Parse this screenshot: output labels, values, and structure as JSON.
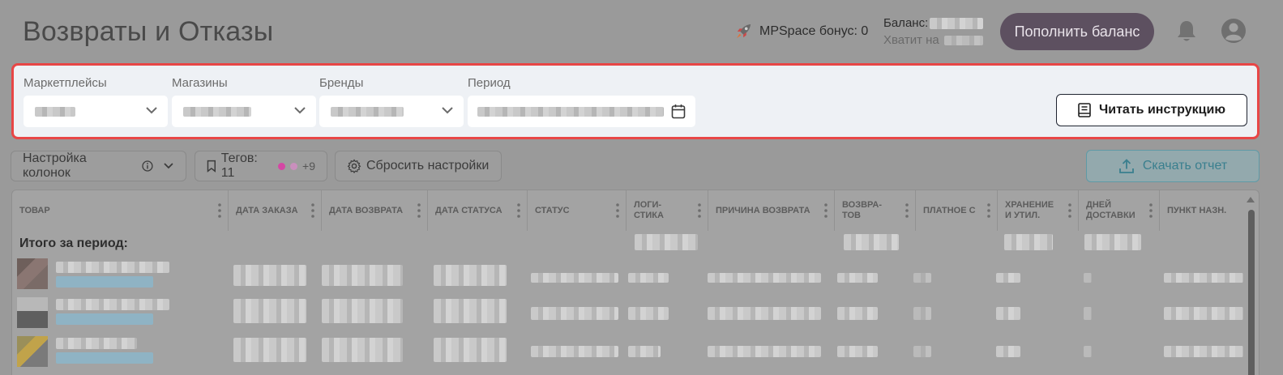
{
  "header": {
    "title": "Возвраты и Отказы",
    "bonus_label": "MPSpace бонус: 0",
    "balance_label": "Баланс:",
    "enough_label": "Хватит на",
    "topup_button": "Пополнить баланс"
  },
  "filters": {
    "marketplaces_label": "Маркетплейсы",
    "shops_label": "Магазины",
    "brands_label": "Бренды",
    "period_label": "Период",
    "instruction_button": "Читать инструкцию"
  },
  "toolbar": {
    "columns_button": "Настройка колонок",
    "tags_button": "Тегов: 11",
    "tags_more": "+9",
    "tag_colors": [
      "#e04fb0",
      "#d89bcc"
    ],
    "reset_button": "Сбросить настройки",
    "download_button": "Скачать отчет"
  },
  "table": {
    "columns": [
      "Товар",
      "Дата заказа",
      "Дата возврата",
      "Дата статуса",
      "Статус",
      "Логи-\nстика",
      "Причина возврата",
      "Возвра-\nтов",
      "Платное с",
      "Хранение\nи утил.",
      "Дней\nдоставки",
      "Пункт назн."
    ],
    "total_label": "Итого за период:"
  },
  "colors": {
    "accent_red": "#e84646",
    "topup_bg": "#5d5060",
    "download_fg": "#3a7f8e"
  }
}
